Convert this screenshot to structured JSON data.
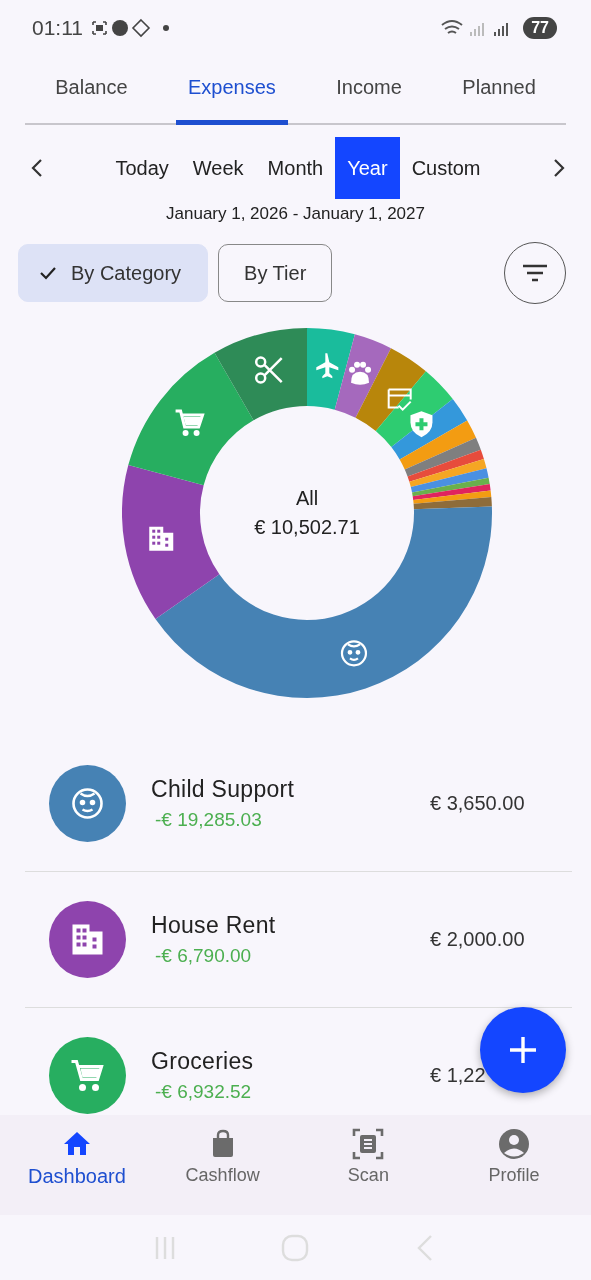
{
  "status_bar": {
    "time": "01:11",
    "battery": "77"
  },
  "tabs": [
    {
      "label": "Balance",
      "selected": false
    },
    {
      "label": "Expenses",
      "selected": true
    },
    {
      "label": "Income",
      "selected": false
    },
    {
      "label": "Planned",
      "selected": false
    }
  ],
  "periods": [
    {
      "label": "Today",
      "selected": false
    },
    {
      "label": "Week",
      "selected": false
    },
    {
      "label": "Month",
      "selected": false
    },
    {
      "label": "Year",
      "selected": true
    },
    {
      "label": "Custom",
      "selected": false
    }
  ],
  "date_range": "January 1, 2026 - January 1, 2027",
  "chips": [
    {
      "label": "By Category",
      "selected": true
    },
    {
      "label": "By Tier",
      "selected": false
    }
  ],
  "chart": {
    "center_label": "All",
    "center_value": "€ 10,502.71"
  },
  "categories": [
    {
      "color": "#4682b4",
      "name": "Child Support",
      "difference": "-€ 19,285.03",
      "amount": "€ 3,650.00"
    },
    {
      "color": "#8e44ad",
      "name": "House Rent",
      "difference": "-€ 6,790.00",
      "amount": "€ 2,000.00"
    },
    {
      "color": "#27ae60",
      "name": "Groceries",
      "difference": "-€ 6,932.52",
      "amount": "€ 1,22"
    }
  ],
  "bottom_nav": [
    {
      "label": "Dashboard",
      "selected": true
    },
    {
      "label": "Cashflow",
      "selected": false
    },
    {
      "label": "Scan",
      "selected": false
    },
    {
      "label": "Profile",
      "selected": false
    }
  ]
}
